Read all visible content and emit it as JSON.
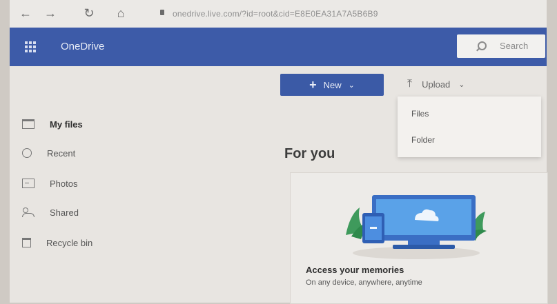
{
  "browser": {
    "back_glyph": "←",
    "forward_glyph": "→",
    "reload_glyph": "↻",
    "home_glyph": "⌂",
    "url": "onedrive.live.com/?id=root&cid=E8E0EA31A7A5B6B9"
  },
  "app": {
    "title": "OneDrive",
    "accent_color": "#3d5ba8",
    "search_placeholder": "Search"
  },
  "sidebar": {
    "items": [
      {
        "label": "My files",
        "icon": "folder-icon",
        "active": true
      },
      {
        "label": "Recent",
        "icon": "clock-icon"
      },
      {
        "label": "Photos",
        "icon": "photo-icon"
      },
      {
        "label": "Shared",
        "icon": "people-icon"
      },
      {
        "label": "Recycle bin",
        "icon": "bin-icon"
      }
    ]
  },
  "toolbar": {
    "new_label": "New",
    "upload_label": "Upload"
  },
  "upload_menu": {
    "items": [
      "Files",
      "Folder"
    ]
  },
  "main": {
    "section_title": "For you",
    "card": {
      "title": "Access your memories",
      "subtitle": "On any device, anywhere, anytime"
    }
  }
}
